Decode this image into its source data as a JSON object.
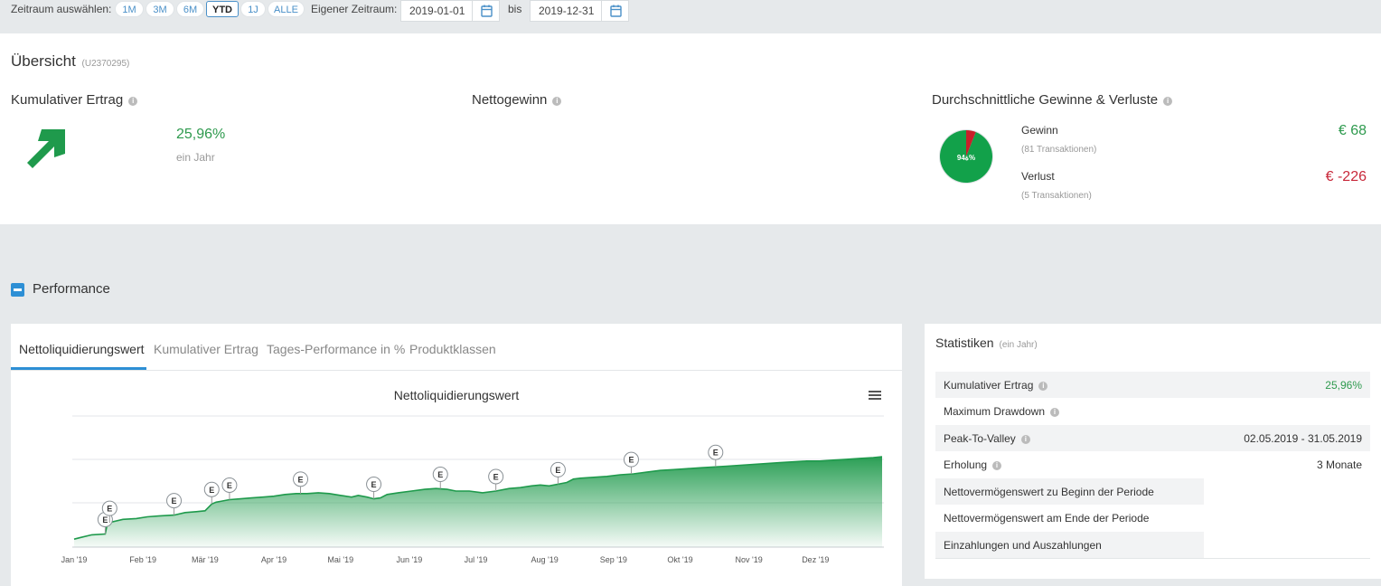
{
  "topbar": {
    "range_label": "Zeitraum auswählen:",
    "ranges": [
      "1M",
      "3M",
      "6M",
      "YTD",
      "1J",
      "ALLE"
    ],
    "active_range": "YTD",
    "custom_label": "Eigener Zeitraum:",
    "from_date": "2019-01-01",
    "to_label": "bis",
    "to_date": "2019-12-31",
    "calendar_icon": "calendar-icon"
  },
  "overview": {
    "title": "Übersicht",
    "account": "(U2370295)",
    "cumulative": {
      "title": "Kumulativer Ertrag",
      "value": "25,96%",
      "period": "ein Jahr",
      "icon": "arrow-up-right-icon"
    },
    "net_profit": {
      "title": "Nettogewinn"
    },
    "avg": {
      "title": "Durchschnittliche Gewinne & Verluste",
      "pie_label": "ة94%",
      "pie_gain_fraction": 0.94,
      "gain": {
        "label": "Gewinn",
        "sub": "(81 Transaktionen)",
        "value": "€ 68"
      },
      "loss": {
        "label": "Verlust",
        "sub": "(5 Transaktionen)",
        "value": "€ -226"
      }
    },
    "info_glyph": "i"
  },
  "performance": {
    "title": "Performance",
    "tabs": [
      "Nettoliquidierungswert",
      "Kumulativer Ertrag",
      "Tages-Performance in %",
      "Produktklassen"
    ],
    "active_tab": 0
  },
  "chart_data": {
    "type": "area",
    "title": "Nettoliquidierungswert",
    "xlabel": "",
    "ylabel": "",
    "x_tick_labels": [
      "Jan '19",
      "Feb '19",
      "Mär '19",
      "Apr '19",
      "Mai '19",
      "Jun '19",
      "Jul '19",
      "Aug '19",
      "Sep '19",
      "Okt '19",
      "Nov '19",
      "Dez '19"
    ],
    "x_range_days": [
      0,
      364
    ],
    "y_range": [
      0,
      1
    ],
    "grid": true,
    "x": [
      0,
      3,
      8,
      14,
      15,
      17,
      22,
      28,
      33,
      38,
      45,
      50,
      55,
      59,
      62,
      64,
      66,
      70,
      75,
      80,
      85,
      90,
      95,
      100,
      105,
      110,
      115,
      120,
      125,
      128,
      132,
      135,
      138,
      141,
      146,
      152,
      158,
      163,
      168,
      172,
      178,
      184,
      190,
      196,
      201,
      206,
      210,
      214,
      218,
      222,
      225,
      228,
      234,
      240,
      246,
      252,
      258,
      264,
      270,
      276,
      282,
      288,
      294,
      300,
      306,
      312,
      318,
      324,
      330,
      336,
      342,
      348,
      354,
      360,
      364
    ],
    "y": [
      0.04,
      0.06,
      0.09,
      0.1,
      0.22,
      0.24,
      0.27,
      0.28,
      0.3,
      0.31,
      0.32,
      0.35,
      0.36,
      0.37,
      0.45,
      0.47,
      0.48,
      0.5,
      0.51,
      0.52,
      0.53,
      0.54,
      0.56,
      0.57,
      0.57,
      0.58,
      0.57,
      0.55,
      0.53,
      0.55,
      0.53,
      0.51,
      0.52,
      0.56,
      0.58,
      0.6,
      0.62,
      0.63,
      0.62,
      0.6,
      0.6,
      0.58,
      0.6,
      0.63,
      0.64,
      0.66,
      0.67,
      0.66,
      0.68,
      0.7,
      0.74,
      0.75,
      0.76,
      0.77,
      0.79,
      0.8,
      0.82,
      0.84,
      0.85,
      0.86,
      0.87,
      0.88,
      0.89,
      0.9,
      0.91,
      0.92,
      0.93,
      0.94,
      0.95,
      0.95,
      0.96,
      0.97,
      0.98,
      0.99,
      1.0
    ],
    "event_flags": {
      "label": "E",
      "days": [
        14,
        16,
        45,
        62,
        70,
        102,
        135,
        165,
        190,
        218,
        251,
        289
      ]
    },
    "menu_icon": "hamburger-icon"
  },
  "stats": {
    "title": "Statistiken",
    "period": "(ein Jahr)",
    "rows": [
      {
        "label": "Kumulativer Ertrag",
        "value": "25,96%",
        "info": true,
        "green": true
      },
      {
        "label": "Maximum Drawdown",
        "value": "",
        "info": true
      },
      {
        "label": "Peak-To-Valley",
        "value": "02.05.2019 - 31.05.2019",
        "info": true
      },
      {
        "label": "Erholung",
        "value": "3 Monate",
        "info": true
      },
      {
        "label": "Nettovermögenswert zu Beginn der Periode",
        "value": ""
      },
      {
        "label": "Nettovermögenswert am Ende der Periode",
        "value": ""
      },
      {
        "label": "Einzahlungen und Auszahlungen",
        "value": ""
      }
    ]
  },
  "colors": {
    "green": "#2e9a4e",
    "chart_green": "#1f9a4c",
    "red": "#c8283a",
    "blue": "#2d8fd5",
    "pie_gain": "#12a14a",
    "pie_loss": "#c8202a"
  }
}
